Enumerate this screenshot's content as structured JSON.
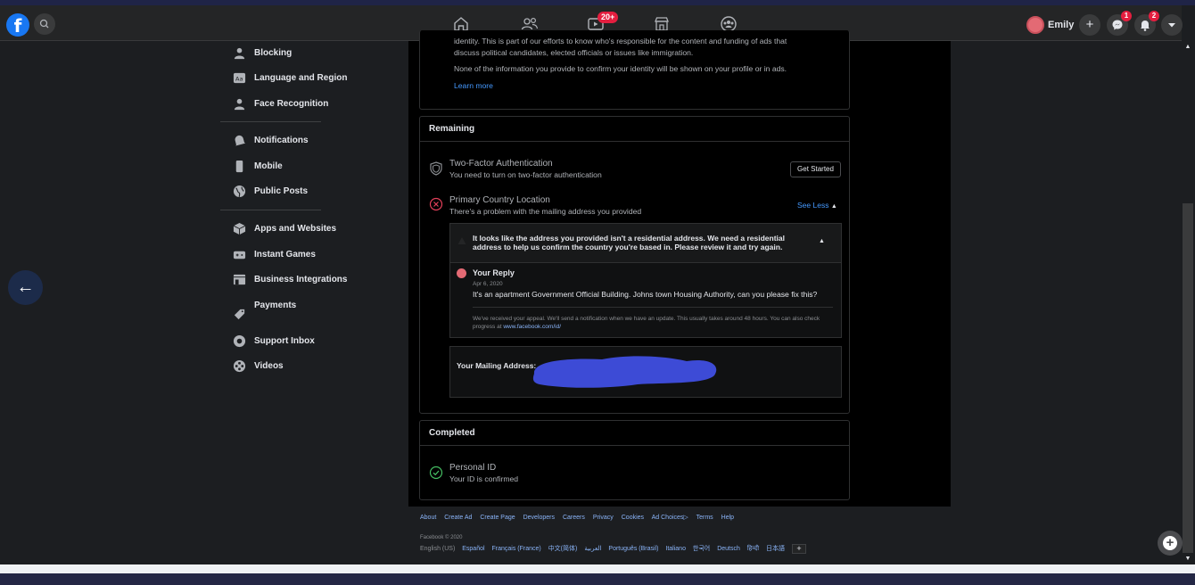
{
  "topbar": {
    "logo": "f",
    "video_badge": "20+",
    "profile_name": "Emily",
    "create_label": "+",
    "messenger_count": "1",
    "notifications_count": "2"
  },
  "sidebar": {
    "items": [
      {
        "label": "Blocking",
        "icon": "person-block-icon"
      },
      {
        "label": "Language and Region",
        "icon": "language-icon"
      },
      {
        "label": "Face Recognition",
        "icon": "face-icon"
      },
      {
        "label": "Notifications",
        "icon": "bell-icon"
      },
      {
        "label": "Mobile",
        "icon": "mobile-icon"
      },
      {
        "label": "Public Posts",
        "icon": "globe-icon"
      },
      {
        "label": "Apps and Websites",
        "icon": "cube-icon"
      },
      {
        "label": "Instant Games",
        "icon": "gamepad-icon"
      },
      {
        "label": "Business Integrations",
        "icon": "business-icon"
      },
      {
        "label": "Payments",
        "icon": "tag-icon"
      },
      {
        "label": "Support Inbox",
        "icon": "lifebuoy-icon"
      },
      {
        "label": "Videos",
        "icon": "film-icon"
      }
    ]
  },
  "intro": {
    "line1": "identity. This is part of our efforts to know who's responsible for the content and funding of ads that",
    "line2": "discuss political candidates, elected officials or issues like immigration.",
    "line3": "None of the information you provide to confirm your identity will be shown on your profile or in ads.",
    "learn_more": "Learn more"
  },
  "remaining": {
    "title": "Remaining",
    "two_factor": {
      "title": "Two-Factor Authentication",
      "subtitle": "You need to turn on two-factor authentication",
      "button": "Get Started"
    },
    "country": {
      "title": "Primary Country Location",
      "subtitle": "There's a problem with the mailing address you provided",
      "toggle": "See Less",
      "warning": "It looks like the address you provided isn't a residential address. We need a residential address to help us confirm the country you're based in. Please review it and try again.",
      "reply_label": "Your Reply",
      "reply_date": "Apr 6, 2020",
      "reply_text": "It's an apartment Government Official Building. Johns town Housing Authority, can you please fix this?",
      "appeal_note": "We've received your appeal. We'll send a notification when we have an update. This usually takes around 48 hours. You can also check progress at",
      "appeal_link": "www.facebook.com/id/",
      "mailing_label": "Your Mailing Address:"
    }
  },
  "completed": {
    "title": "Completed",
    "personal_id": {
      "title": "Personal ID",
      "subtitle": "Your ID is confirmed"
    }
  },
  "footer": {
    "links": [
      "About",
      "Create Ad",
      "Create Page",
      "Developers",
      "Careers",
      "Privacy",
      "Cookies",
      "Ad Choices▷",
      "Terms",
      "Help"
    ],
    "copyright": "Facebook © 2020",
    "languages": [
      "English (US)",
      "Español",
      "Français (France)",
      "中文(简体)",
      "العربية",
      "Português (Brasil)",
      "Italiano",
      "한국어",
      "Deutsch",
      "हिन्दी",
      "日本語"
    ],
    "more_languages": "+"
  },
  "colors": {
    "accent": "#1877f2",
    "link": "#4599ff",
    "badge": "#e41e3f",
    "redaction": "#3d4bd6",
    "success": "#45bd62",
    "error": "#e4405a"
  }
}
